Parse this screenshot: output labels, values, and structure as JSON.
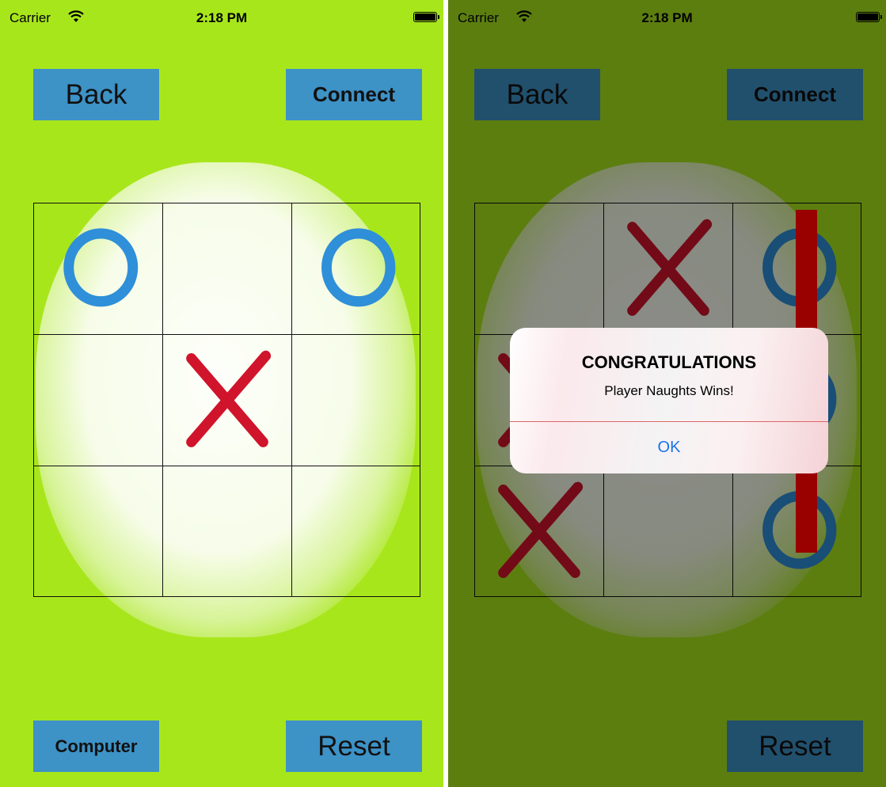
{
  "status": {
    "carrier": "Carrier",
    "time": "2:18 PM"
  },
  "buttons": {
    "back": "Back",
    "connect": "Connect",
    "computer": "Computer",
    "reset": "Reset"
  },
  "board_left": [
    "O",
    "",
    "O",
    "",
    "X",
    "",
    "",
    "",
    ""
  ],
  "board_right": [
    "",
    "X",
    "O",
    "X",
    "",
    "O",
    "X",
    "",
    "O"
  ],
  "alert": {
    "title": "CONGRATULATIONS",
    "message": "Player Naughts Wins!",
    "ok": "OK"
  },
  "colors": {
    "background": "#a8e61c",
    "button": "#3d92c6",
    "x_mark": "#d0142b",
    "o_mark": "#2f8fd8",
    "win_line": "#990000",
    "ok_text": "#1a73e8"
  },
  "icons": {
    "wifi": "wifi-icon",
    "battery": "battery-icon"
  }
}
